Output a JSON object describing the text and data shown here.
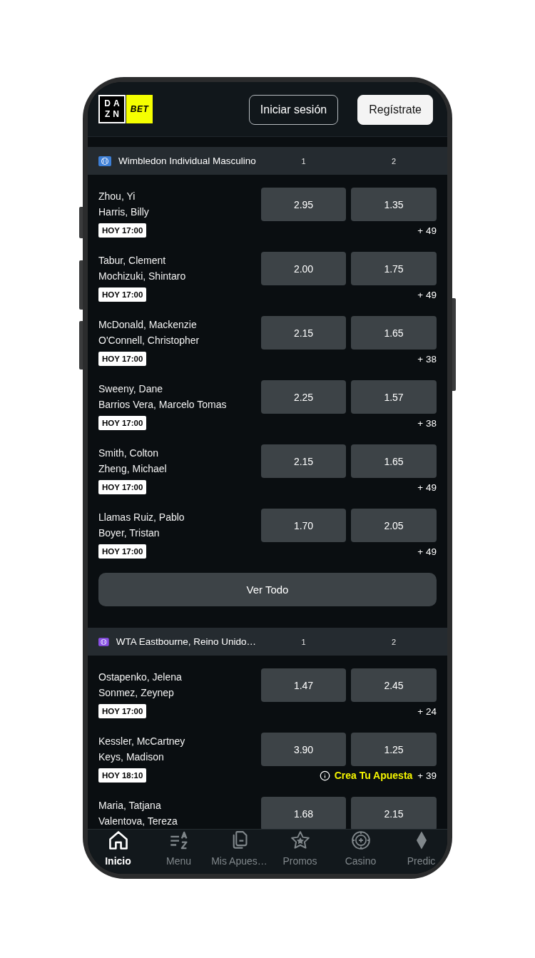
{
  "header": {
    "logo": {
      "wordmark": [
        "DA",
        "ZN"
      ],
      "tag": "BET"
    },
    "buttons": [
      {
        "label": "Iniciar sesión",
        "kind": "outline"
      },
      {
        "label": "Regístrate",
        "kind": "solid"
      }
    ]
  },
  "sections": [
    {
      "title": "Wimbledon Individual Masculino",
      "color": "#3d7fd6",
      "columns": [
        "1",
        "2"
      ],
      "matches": [
        {
          "players": [
            "Zhou, Yi",
            "Harris, Billy"
          ],
          "time": "HOY 17:00",
          "odds": [
            "2.95",
            "1.35"
          ],
          "more": "+ 49"
        },
        {
          "players": [
            "Tabur, Clement",
            "Mochizuki, Shintaro"
          ],
          "time": "HOY 17:00",
          "odds": [
            "2.00",
            "1.75"
          ],
          "more": "+ 49"
        },
        {
          "players": [
            "McDonald, Mackenzie",
            "O'Connell, Christopher"
          ],
          "time": "HOY 17:00",
          "odds": [
            "2.15",
            "1.65"
          ],
          "more": "+ 38"
        },
        {
          "players": [
            "Sweeny, Dane",
            "Barrios Vera, Marcelo Tomas"
          ],
          "time": "HOY 17:00",
          "odds": [
            "2.25",
            "1.57"
          ],
          "more": "+ 38"
        },
        {
          "players": [
            "Smith, Colton",
            "Zheng, Michael"
          ],
          "time": "HOY 17:00",
          "odds": [
            "2.15",
            "1.65"
          ],
          "more": "+ 49"
        },
        {
          "players": [
            "Llamas Ruiz, Pablo",
            "Boyer, Tristan"
          ],
          "time": "HOY 17:00",
          "odds": [
            "1.70",
            "2.05"
          ],
          "more": "+ 49"
        }
      ],
      "view_all": "Ver Todo"
    },
    {
      "title": "WTA Eastbourne, Reino Unido…",
      "color": "#8a4fe6",
      "columns": [
        "1",
        "2"
      ],
      "matches": [
        {
          "players": [
            "Ostapenko, Jelena",
            "Sonmez, Zeynep"
          ],
          "time": "HOY 17:00",
          "odds": [
            "1.47",
            "2.45"
          ],
          "more": "+ 24"
        },
        {
          "players": [
            "Kessler, McCartney",
            "Keys, Madison"
          ],
          "time": "HOY 18:10",
          "odds": [
            "3.90",
            "1.25"
          ],
          "promo": "Crea Tu Apuesta",
          "more": "+ 39"
        },
        {
          "players": [
            "Maria, Tatjana",
            "Valentova, Tereza"
          ],
          "odds": [
            "1.68",
            "2.15"
          ]
        }
      ]
    }
  ],
  "bottom_nav": [
    {
      "label": "Inicio",
      "kind": "home",
      "selected": true
    },
    {
      "label": "Menu",
      "kind": "menu",
      "selected": false
    },
    {
      "label": "Mis Apues…",
      "kind": "bets",
      "selected": false
    },
    {
      "label": "Promos",
      "kind": "promos",
      "selected": false
    },
    {
      "label": "Casino",
      "kind": "casino",
      "selected": false
    },
    {
      "label": "Predic",
      "kind": "predict",
      "selected": false
    }
  ]
}
